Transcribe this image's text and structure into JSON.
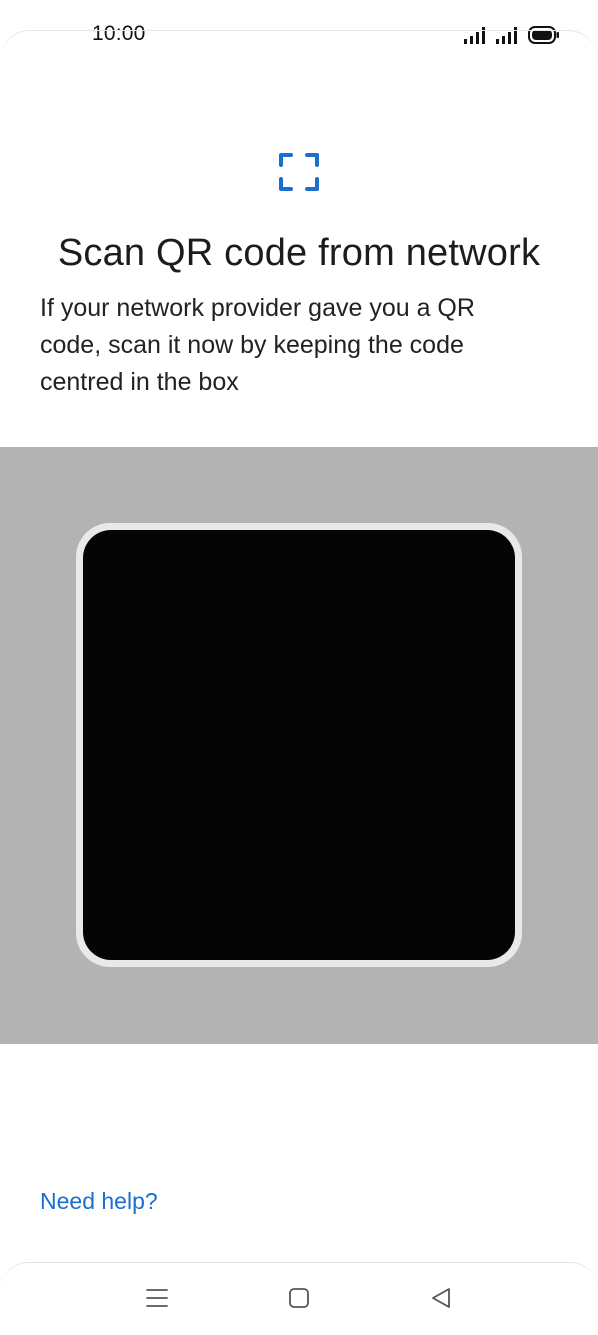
{
  "status_bar": {
    "time": "10:00",
    "icons": [
      "signal-icon",
      "signal-icon",
      "battery-icon"
    ]
  },
  "header": {
    "icon": "qr-scan-icon",
    "title": "Scan QR code from network",
    "description": "If your network provider gave you a QR code, scan it now by keeping the code centred in the box"
  },
  "footer": {
    "help_link": "Need help?"
  },
  "nav_bar": {
    "icons": [
      "menu-icon",
      "home-icon",
      "back-icon"
    ]
  },
  "colors": {
    "accent": "#1a6fcf",
    "scanner_background": "#b3b3b3",
    "camera_view": "#050505",
    "frame": "#e9e9ec"
  }
}
